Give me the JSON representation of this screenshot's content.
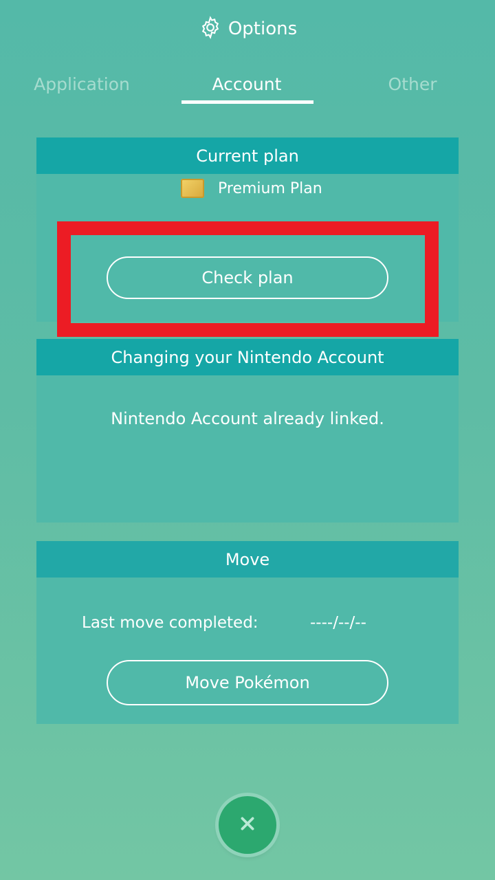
{
  "header": {
    "title": "Options",
    "icon": "gear-icon"
  },
  "tabs": [
    {
      "label": "Application",
      "active": false
    },
    {
      "label": "Account",
      "active": true
    },
    {
      "label": "Other",
      "active": false
    }
  ],
  "current_plan": {
    "heading": "Current plan",
    "plan_name": "Premium Plan",
    "check_button": "Check plan"
  },
  "nintendo_account": {
    "heading": "Changing your Nintendo Account",
    "status": "Nintendo Account already linked."
  },
  "move": {
    "heading": "Move",
    "last_move_label": "Last move completed:",
    "last_move_value": "----/--/--",
    "move_button": "Move Pokémon"
  },
  "colors": {
    "header_bar": "#15a6a6",
    "highlight": "#ec1c24",
    "close_button": "#2ca86f"
  }
}
